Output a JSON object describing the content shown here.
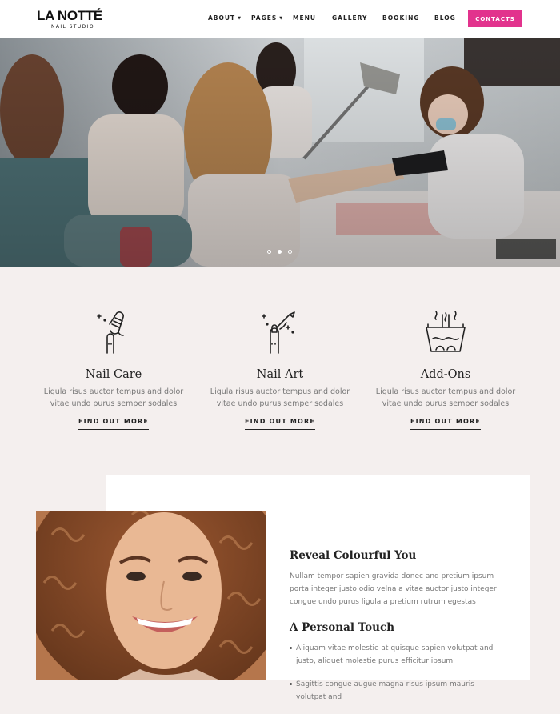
{
  "brand": {
    "name": "LA NOTTÉ",
    "tagline": "NAIL STUDIO"
  },
  "nav": {
    "items": [
      "ABOUT",
      "PAGES",
      "MENU",
      "GALLERY",
      "BOOKING",
      "BLOG"
    ],
    "contacts_label": "CONTACTS",
    "accent_color": "#e2338d"
  },
  "hero": {
    "slide_count": 3,
    "active_slide": 2
  },
  "services": [
    {
      "icon": "nail-polish-bottle-icon",
      "title": "Nail Care",
      "desc_line1": "Ligula risus auctor tempus and dolor",
      "desc_line2": "vitae undo purus semper sodales",
      "link": "FIND OUT MORE"
    },
    {
      "icon": "nail-brush-icon",
      "title": "Nail Art",
      "desc_line1": "Ligula risus auctor tempus and dolor",
      "desc_line2": "vitae undo purus semper sodales",
      "link": "FIND OUT MORE"
    },
    {
      "icon": "foot-bath-icon",
      "title": "Add-Ons",
      "desc_line1": "Ligula risus auctor tempus and dolor",
      "desc_line2": "vitae undo purus semper sodales",
      "link": "FIND OUT MORE"
    }
  ],
  "about": {
    "heading1": "Reveal Colourful You",
    "para1_line1": "Nullam tempor sapien gravida donec and pretium ipsum",
    "para1_line2": "porta integer justo odio velna a vitae auctor justo integer",
    "para1_line3": "congue undo purus ligula a pretium rutrum egestas",
    "heading2": "A Personal Touch",
    "bullet1_line1": "Aliquam vitae molestie at quisque sapien volutpat and",
    "bullet1_line2": "justo, aliquet molestie purus efficitur ipsum",
    "bullet2_line1": "Sagittis congue augue magna risus ipsum mauris volutpat and"
  }
}
